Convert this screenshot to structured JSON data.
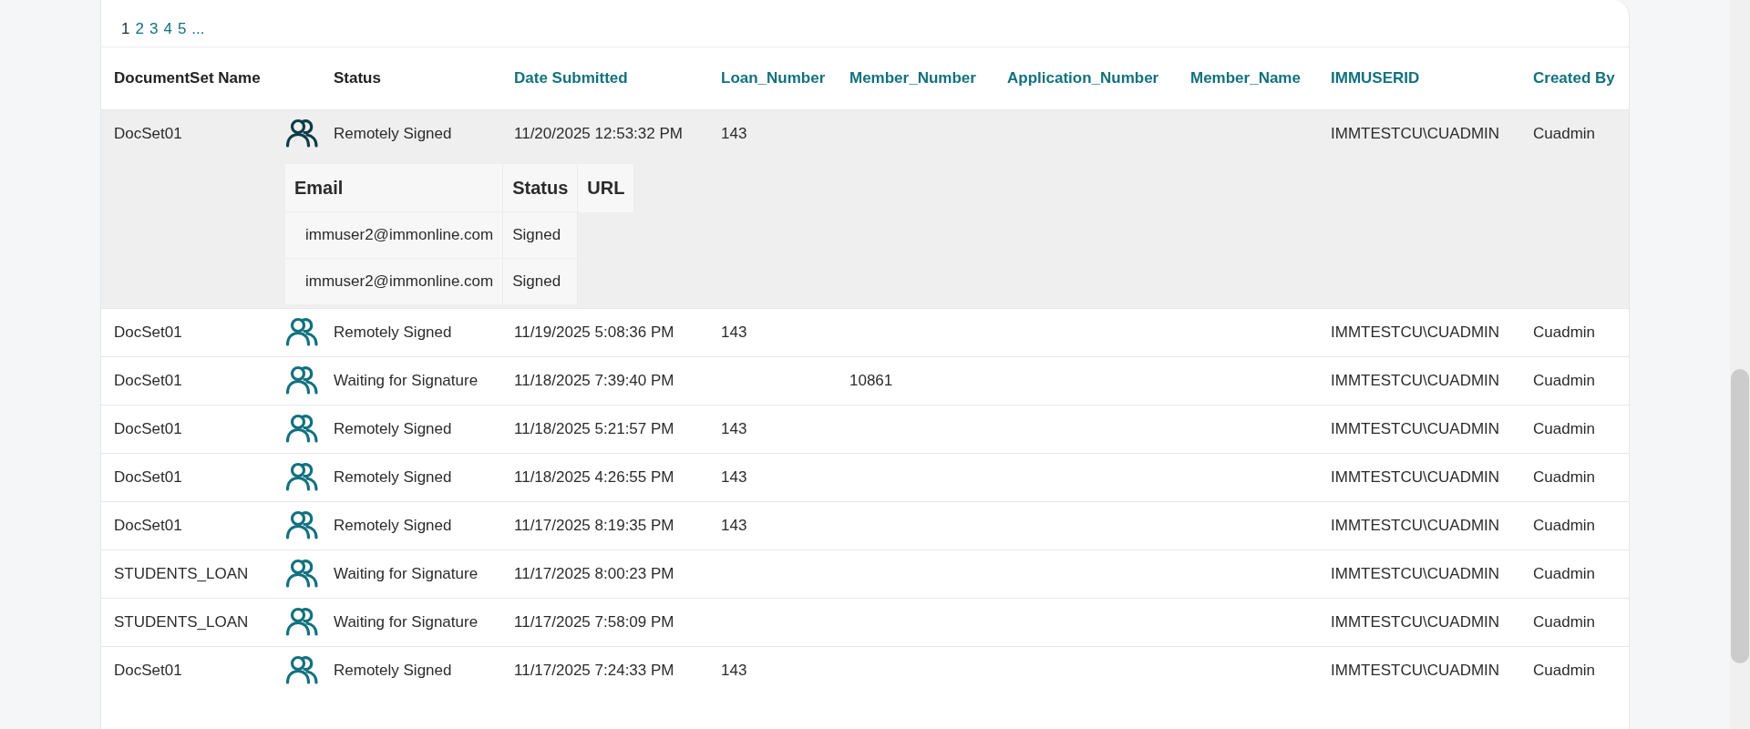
{
  "pagination": {
    "pages": [
      {
        "label": "1",
        "selected": true
      },
      {
        "label": "2",
        "selected": false
      },
      {
        "label": "3",
        "selected": false
      },
      {
        "label": "4",
        "selected": false
      },
      {
        "label": "5",
        "selected": false
      }
    ],
    "more": "..."
  },
  "table": {
    "columns": [
      {
        "label": "DocumentSet Name",
        "sortable": false
      },
      {
        "label": "Status",
        "sortable": false
      },
      {
        "label": "Date Submitted",
        "sortable": true
      },
      {
        "label": "Loan_Number",
        "sortable": true
      },
      {
        "label": "Member_Number",
        "sortable": true
      },
      {
        "label": "Application_Number",
        "sortable": true
      },
      {
        "label": "Member_Name",
        "sortable": true
      },
      {
        "label": "IMMUSERID",
        "sortable": true
      },
      {
        "label": "Created By",
        "sortable": true
      }
    ],
    "rows": [
      {
        "name": "DocSet01",
        "status": "Remotely Signed",
        "date": "11/20/2025 12:53:32 PM",
        "loan": "143",
        "member": "",
        "application": "",
        "member_name": "",
        "userid": "IMMTESTCU\\CUADMIN",
        "created_by": "Cuadmin",
        "expanded": true,
        "signers": {
          "columns": [
            "Email",
            "Status",
            "URL"
          ],
          "rows": [
            {
              "email": "immuser2@immonline.com",
              "status": "Signed"
            },
            {
              "email": "immuser2@immonline.com",
              "status": "Signed"
            }
          ]
        }
      },
      {
        "name": "DocSet01",
        "status": "Remotely Signed",
        "date": "11/19/2025 5:08:36 PM",
        "loan": "143",
        "member": "",
        "application": "",
        "member_name": "",
        "userid": "IMMTESTCU\\CUADMIN",
        "created_by": "Cuadmin",
        "expanded": false
      },
      {
        "name": "DocSet01",
        "status": "Waiting for Signature",
        "date": "11/18/2025 7:39:40 PM",
        "loan": "",
        "member": "10861",
        "application": "",
        "member_name": "",
        "userid": "IMMTESTCU\\CUADMIN",
        "created_by": "Cuadmin",
        "expanded": false
      },
      {
        "name": "DocSet01",
        "status": "Remotely Signed",
        "date": "11/18/2025 5:21:57 PM",
        "loan": "143",
        "member": "",
        "application": "",
        "member_name": "",
        "userid": "IMMTESTCU\\CUADMIN",
        "created_by": "Cuadmin",
        "expanded": false
      },
      {
        "name": "DocSet01",
        "status": "Remotely Signed",
        "date": "11/18/2025 4:26:55 PM",
        "loan": "143",
        "member": "",
        "application": "",
        "member_name": "",
        "userid": "IMMTESTCU\\CUADMIN",
        "created_by": "Cuadmin",
        "expanded": false
      },
      {
        "name": "DocSet01",
        "status": "Remotely Signed",
        "date": "11/17/2025 8:19:35 PM",
        "loan": "143",
        "member": "",
        "application": "",
        "member_name": "",
        "userid": "IMMTESTCU\\CUADMIN",
        "created_by": "Cuadmin",
        "expanded": false
      },
      {
        "name": "STUDENTS_LOAN",
        "status": "Waiting for Signature",
        "date": "11/17/2025 8:00:23 PM",
        "loan": "",
        "member": "",
        "application": "",
        "member_name": "",
        "userid": "IMMTESTCU\\CUADMIN",
        "created_by": "Cuadmin",
        "expanded": false
      },
      {
        "name": "STUDENTS_LOAN",
        "status": "Waiting for Signature",
        "date": "11/17/2025 7:58:09 PM",
        "loan": "",
        "member": "",
        "application": "",
        "member_name": "",
        "userid": "IMMTESTCU\\CUADMIN",
        "created_by": "Cuadmin",
        "expanded": false
      },
      {
        "name": "DocSet01",
        "status": "Remotely Signed",
        "date": "11/17/2025 7:24:33 PM",
        "loan": "143",
        "member": "",
        "application": "",
        "member_name": "",
        "userid": "IMMTESTCU\\CUADMIN",
        "created_by": "Cuadmin",
        "expanded": false
      }
    ]
  }
}
